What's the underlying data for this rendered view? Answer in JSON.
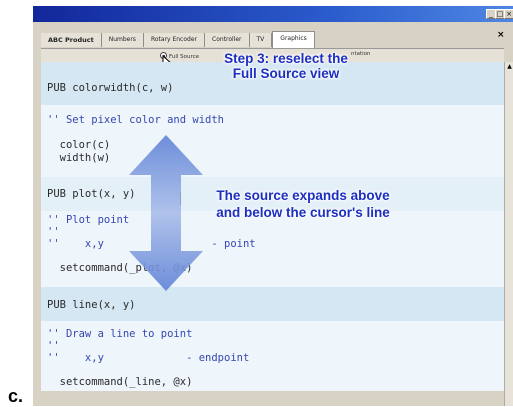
{
  "window": {
    "minimize_glyph": "_",
    "maximize_glyph": "□",
    "close_glyph": "×",
    "panel_close_glyph": "×"
  },
  "tabs": [
    {
      "label": "ABC Product",
      "active": false
    },
    {
      "label": "Numbers",
      "active": false
    },
    {
      "label": "Rotary Encoder",
      "active": false
    },
    {
      "label": "Controller",
      "active": false
    },
    {
      "label": "TV",
      "active": false
    },
    {
      "label": "Graphics",
      "active": true
    }
  ],
  "view_options": {
    "full_source": "Full Source",
    "partial": "ntation"
  },
  "editor": {
    "sections": [
      {
        "pub_line": "PUB colorwidth(c, w)",
        "comment_lines": [
          "'' Set pixel color and width"
        ],
        "code_lines": [
          "  color(c)",
          "  width(w)"
        ]
      },
      {
        "pub_line": "PUB plot(x, y)",
        "comment_lines": [
          "'' Plot point",
          "''",
          "''    x,y                 - point"
        ],
        "code_lines": [
          "  setcommand(_plot, @x)"
        ]
      },
      {
        "pub_line": "PUB line(x, y)",
        "comment_lines": [
          "'' Draw a line to point",
          "''",
          "''    x,y             - endpoint"
        ],
        "code_lines": [
          "  setcommand(_line, @x)"
        ]
      }
    ]
  },
  "callouts": {
    "step3_line1": "Step 3: reselect the",
    "step3_line2": "Full Source view",
    "expand_line1": "The source expands above",
    "expand_line2": "and below the cursor's line"
  },
  "caption": "c.",
  "colors": {
    "callout_text": "#1c2fc0",
    "arrow": "#5f82d6",
    "pub_background": "#d6e7f4",
    "comment_text": "#3648b0"
  }
}
